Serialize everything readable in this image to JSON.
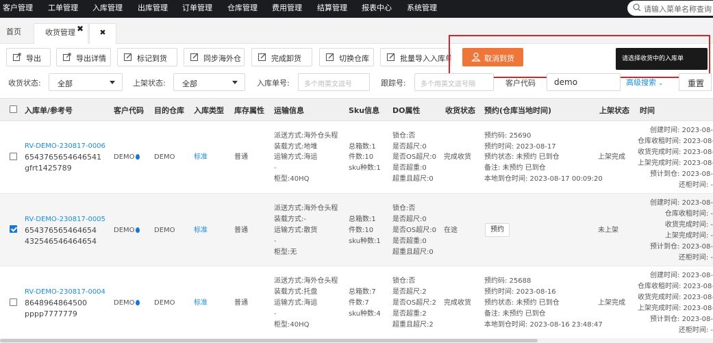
{
  "topnav": {
    "items": [
      "客户管理",
      "工单管理",
      "入库管理",
      "出库管理",
      "订单管理",
      "仓库管理",
      "费用管理",
      "结算管理",
      "报表中心",
      "系统管理"
    ],
    "search_placeholder": "请输入菜单名称查询"
  },
  "tabs": [
    {
      "label": "首页"
    },
    {
      "label": "收货管理",
      "close": "✖"
    },
    {
      "label": "✖"
    }
  ],
  "toolbar": {
    "buttons": [
      "导出",
      "导出详情",
      "标记到货",
      "同步海外仓",
      "完成卸货",
      "切换仓库",
      "批量导入入库单"
    ],
    "cancel_arrival": "取消到货",
    "tooltip": "请选择收货中的入库单"
  },
  "filters": {
    "receive_status_label": "收货状态:",
    "receive_status_value": "全部",
    "shelf_status_label": "上架状态:",
    "shelf_status_value": "全部",
    "inbound_no_label": "入库单号:",
    "inbound_no_placeholder": "多个用英文逗号",
    "tracking_label": "跟踪号:",
    "tracking_placeholder": "多个用英文逗号隔",
    "customer_code_label": "客户代码",
    "customer_code_value": "demo",
    "advanced": "高级搜索",
    "reset": "重置"
  },
  "table": {
    "headers": [
      "入库单/参考号",
      "客户代码",
      "目的仓库",
      "入库类型",
      "库存属性",
      "运输信息",
      "Sku信息",
      "DO属性",
      "收货状态",
      "预约(仓库当地时间)",
      "上架状态",
      "时间"
    ],
    "rows": [
      {
        "id": "RV-DEMO-230817-0006",
        "ref1": "6543765654646541",
        "ref2": "gfrt1425789",
        "customer": "DEMO",
        "warehouse": "DEMO",
        "type": "标准",
        "stock": "普通",
        "transport": [
          "派送方式:海外仓头程",
          "装载方式:地堆",
          "运输方式:海运",
          "-",
          "柜型:40HQ"
        ],
        "sku": [
          "总箱数:1",
          "件数:10",
          "sku种数:1"
        ],
        "do": [
          "锁仓:否",
          "是否超尺:0",
          "是否OS超尺:0",
          "是否超重:0",
          "超重且超尺:0"
        ],
        "receive_status": "完成收货",
        "reservation": [
          "预约码: 25690",
          "预约时间: 2023-08-17",
          "预约状态: 未预约 已到仓",
          "备注: 未预约 已到仓",
          "本地到仓时间: 2023-08-17 00:09:20"
        ],
        "shelf_status": "上架完成",
        "times": [
          "创建时间: 2023-08-",
          "仓库收租时间: 2023-08-",
          "收货完成时间: 2023-08-",
          "上架完成时间: 2023-08-",
          "预计到仓: 2023-08-",
          "还柜时间: -"
        ],
        "checked": false
      },
      {
        "id": "RV-DEMO-230817-0005",
        "ref1": "654376565464654",
        "ref2": "432546546464654",
        "customer": "DEMO",
        "warehouse": "DEMO",
        "type": "标准",
        "stock": "普通",
        "transport": [
          "派送方式:海外仓头程",
          "装载方式:-",
          "运输方式:散货",
          "-",
          "柜型:无"
        ],
        "sku": [
          "总箱数:1",
          "件数:10",
          "sku种数:1"
        ],
        "do": [
          "锁仓:否",
          "是否超尺:0",
          "是否OS超尺:0",
          "是否超重:0",
          "超重且超尺:0"
        ],
        "receive_status": "在途",
        "reservation_button": "预约",
        "shelf_status": "未上架",
        "times": [
          "创建时间: 2023-08-",
          "仓库收租时间: -",
          "收货完成时间: -",
          "上架完成时间: -",
          "预计到仓: 2023-08-",
          "还柜时间: -"
        ],
        "checked": true
      },
      {
        "id": "RV-DEMO-230817-0004",
        "ref1": "8648964864500",
        "ref2": "pppp7777779",
        "customer": "DEMO",
        "warehouse": "DEMO",
        "type": "标准",
        "stock": "普通",
        "transport": [
          "派送方式:海外仓头程",
          "装载方式:托盘",
          "运输方式:海运",
          "-",
          "柜型:40HQ"
        ],
        "sku": [
          "总箱数:7",
          "件数:7",
          "sku种数:4"
        ],
        "do": [
          "锁仓:否",
          "是否超尺:2",
          "是否OS超尺:2",
          "是否超重:2",
          "超重且超尺:2"
        ],
        "receive_status": "完成收货",
        "reservation": [
          "预约码: 25688",
          "预约时间: 2023-08-16",
          "预约状态: 未预约 已到仓",
          "备注: 未预约 已到仓",
          "本地到仓时间: 2023-08-16 23:48:47"
        ],
        "shelf_status": "上架完成",
        "times": [
          "创建时间: 2023-08-",
          "仓库收租时间: 2023-08-",
          "收货完成时间: 2023-08-",
          "上架完成时间: 2023-08-",
          "预计到仓: 2023-08-",
          "还柜时间: -"
        ],
        "checked": false
      }
    ]
  },
  "colors": {
    "accent": "#1a8ddb",
    "orange": "#ee7638",
    "highlight": "#e32020",
    "nav_bg": "#1b1c20"
  }
}
